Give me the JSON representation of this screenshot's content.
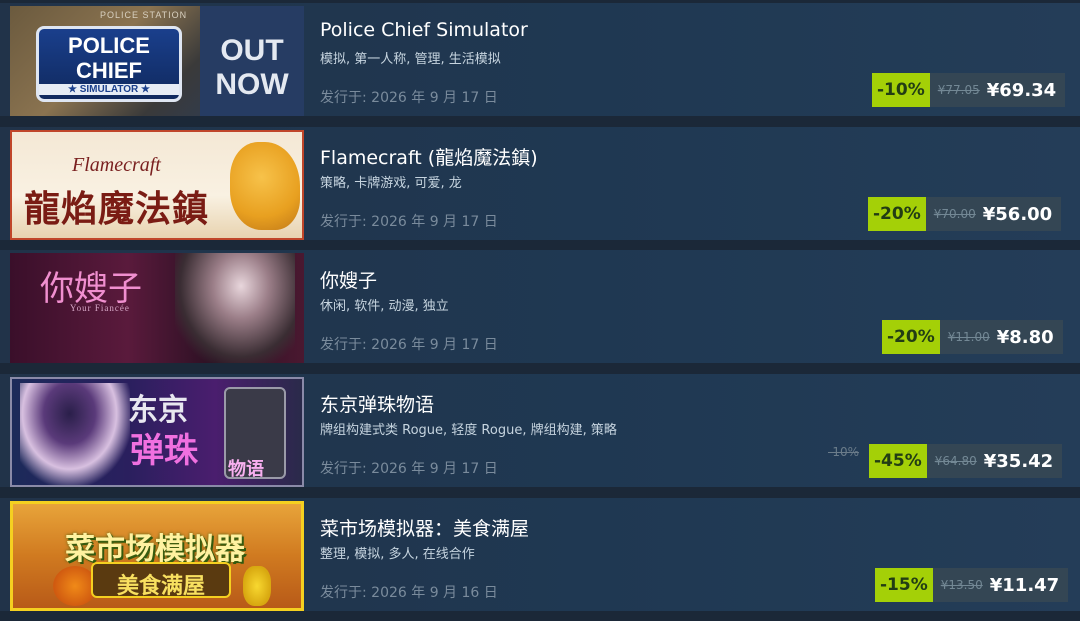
{
  "games": [
    {
      "title": "Police Chief Simulator",
      "tags": "模拟, 第一人称, 管理, 生活模拟",
      "release": "发行于: 2026 年 9 月 17 日",
      "discount": "-10%",
      "original_price": "¥77.05",
      "final_price": "¥69.34",
      "capsule": {
        "logo_line1": "POLICE",
        "logo_line2": "CHIEF",
        "logo_sub": "★ SIMULATOR ★",
        "banner_line1": "OUT",
        "banner_line2": "NOW",
        "sign": "POLICE STATION"
      }
    },
    {
      "title": "Flamecraft (龍焰魔法鎮)",
      "tags": "策略, 卡牌游戏, 可爱, 龙",
      "release": "发行于: 2026 年 9 月 17 日",
      "discount": "-20%",
      "original_price": "¥70.00",
      "final_price": "¥56.00",
      "capsule": {
        "logo_en": "Flamecraft",
        "logo_cn": "龍焰魔法鎮"
      }
    },
    {
      "title": "你嫂子",
      "tags": "休闲, 软件, 动漫, 独立",
      "release": "发行于: 2026 年 9 月 17 日",
      "discount": "-20%",
      "original_price": "¥11.00",
      "final_price": "¥8.80",
      "capsule": {
        "logo_cn": "你嫂子",
        "logo_en": "Your Fiancée"
      }
    },
    {
      "title": "东京弹珠物语",
      "tags": "牌组构建式类 Rogue, 轻度 Rogue, 牌组构建, 策略",
      "release": "发行于: 2026 年 9 月 17 日",
      "extra_discount": "-10%",
      "discount": "-45%",
      "original_price": "¥64.80",
      "final_price": "¥35.42",
      "capsule": {
        "logo_line1": "东京",
        "logo_line2": "弹珠",
        "logo_line3": "物语"
      }
    },
    {
      "title": "菜市场模拟器：美食满屋",
      "tags": "整理, 模拟, 多人, 在线合作",
      "release": "发行于: 2026 年 9 月 16 日",
      "discount": "-15%",
      "original_price": "¥13.50",
      "final_price": "¥11.47",
      "capsule": {
        "logo_line1": "菜市场模拟器",
        "logo_line2": "美食满屋"
      }
    }
  ],
  "colors": {
    "background": "#1b2838",
    "discount_bg": "#a4d007",
    "discount_text": "#223d14",
    "price_bg": "#344654"
  }
}
